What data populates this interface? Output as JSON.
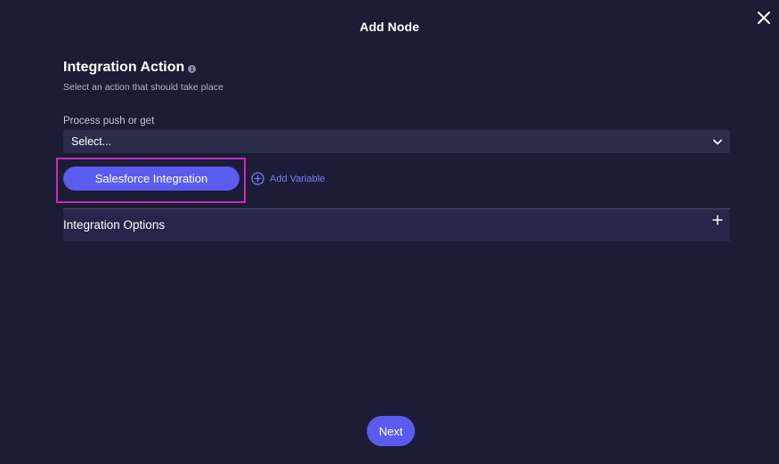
{
  "modal": {
    "title": "Add Node"
  },
  "section": {
    "title": "Integration Action",
    "subtitle": "Select an action that should take place"
  },
  "process_field": {
    "label": "Process push or get",
    "value": "Select..."
  },
  "integration_button": {
    "label": "Salesforce Integration"
  },
  "add_variable": {
    "label": "Add Variable"
  },
  "accordion": {
    "label": "Integration Options"
  },
  "footer": {
    "next_label": "Next"
  },
  "colors": {
    "background": "#1a1d35",
    "accent": "#5a5cf0",
    "highlight": "#d426b5",
    "input_bg": "#2b2c4a",
    "link": "#7a7dff"
  },
  "icons": {
    "close": "close-icon",
    "info": "info-icon",
    "chevron": "chevron-down-icon",
    "add_circle": "plus-circle-icon",
    "expand": "plus-icon"
  }
}
